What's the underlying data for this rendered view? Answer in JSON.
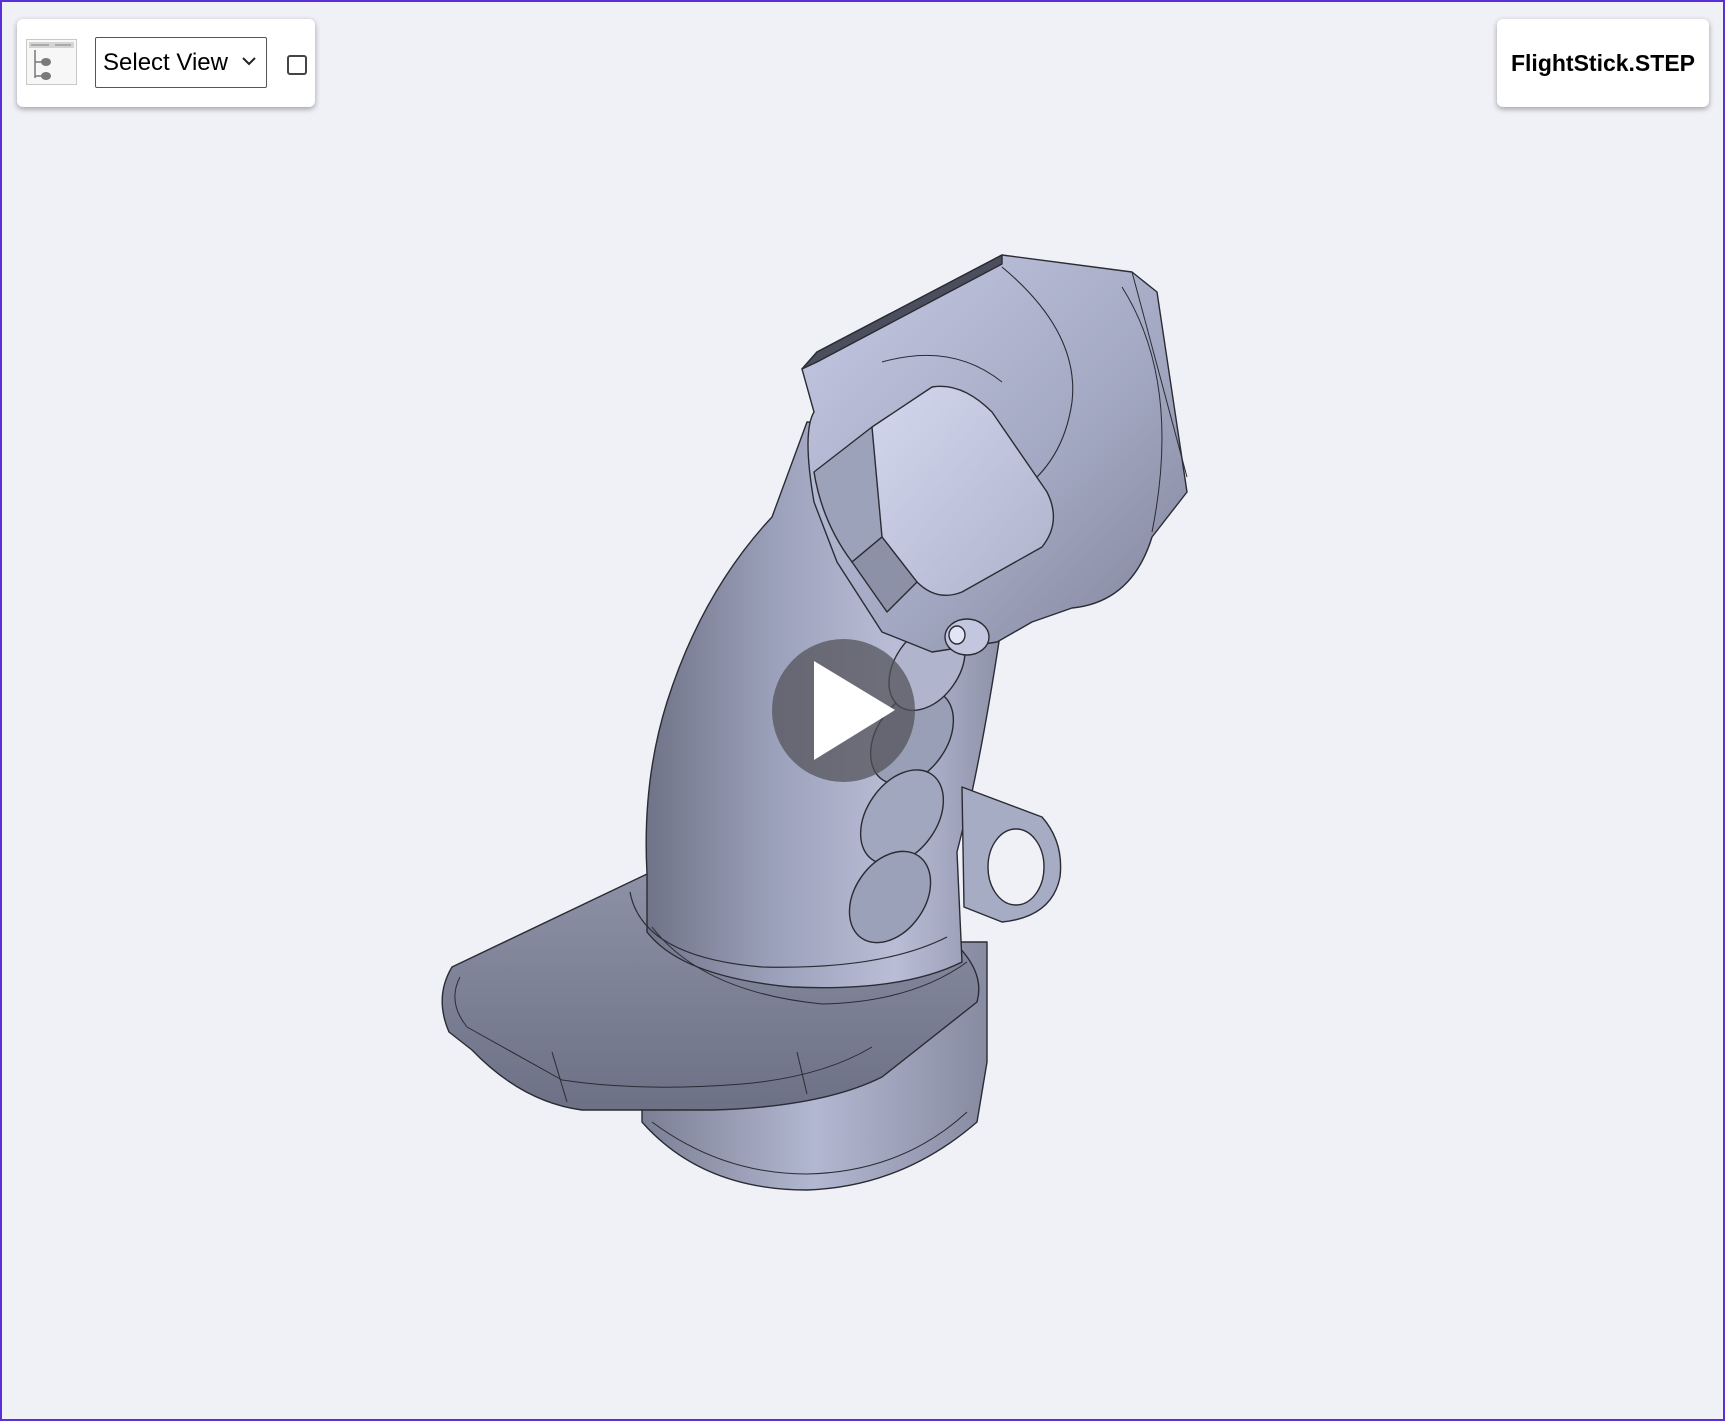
{
  "toolbar": {
    "tree_icon": "model-tree-icon",
    "view_select_value": "Select View",
    "view_select_icon": "chevron-down-icon",
    "checkbox_checked": false
  },
  "file": {
    "name": "FlightStick.STEP"
  },
  "viewport": {
    "background_color": "#f0f1f7",
    "border_color": "#5b2fd6",
    "model_color": "#a6abc4",
    "play_icon": "play-icon"
  }
}
